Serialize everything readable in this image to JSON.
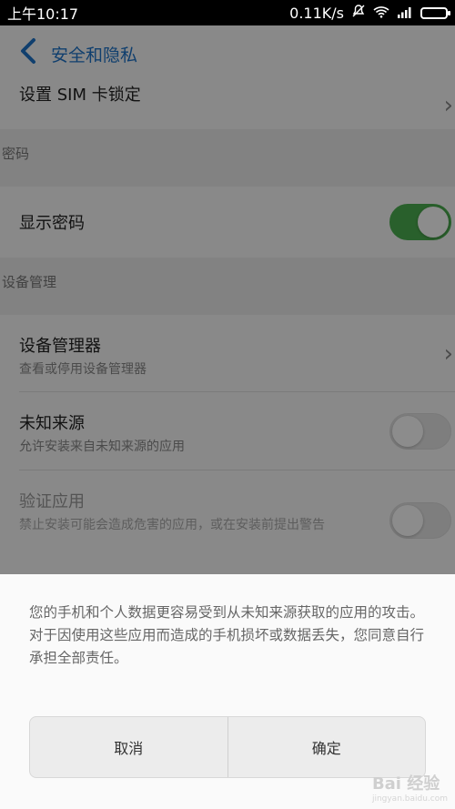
{
  "status_bar": {
    "time": "上午10:17",
    "network_speed": "0.11K/s",
    "icons": [
      "mute-icon",
      "wifi-icon",
      "signal-icon",
      "battery-icon"
    ]
  },
  "header": {
    "back_icon": "chevron-left-icon",
    "title": "安全和隐私"
  },
  "rows": {
    "sim_lock": {
      "title": "设置 SIM 卡锁定"
    },
    "password_section": "密码",
    "show_password": {
      "title": "显示密码",
      "toggle": "on"
    },
    "device_section": "设备管理",
    "device_admin": {
      "title": "设备管理器",
      "subtitle": "查看或停用设备管理器"
    },
    "unknown_sources": {
      "title": "未知来源",
      "subtitle": "允许安装来自未知来源的应用",
      "toggle": "off"
    },
    "verify_apps": {
      "title": "验证应用",
      "subtitle": "禁止安装可能会造成危害的应用，或在安装前提出警告",
      "toggle": "off"
    }
  },
  "dialog": {
    "message": "您的手机和个人数据更容易受到从未知来源获取的应用的攻击。对于因使用这些应用而造成的手机损坏或数据丢失，您同意自行承担全部责任。",
    "cancel_label": "取消",
    "confirm_label": "确定"
  },
  "watermark": {
    "text": "Bai 经验",
    "sub": "jingyan.baidu.com"
  },
  "colors": {
    "accent": "#1e73c8",
    "toggle_on": "#4caf50",
    "overlay": "rgba(0,0,0,0.45)"
  }
}
